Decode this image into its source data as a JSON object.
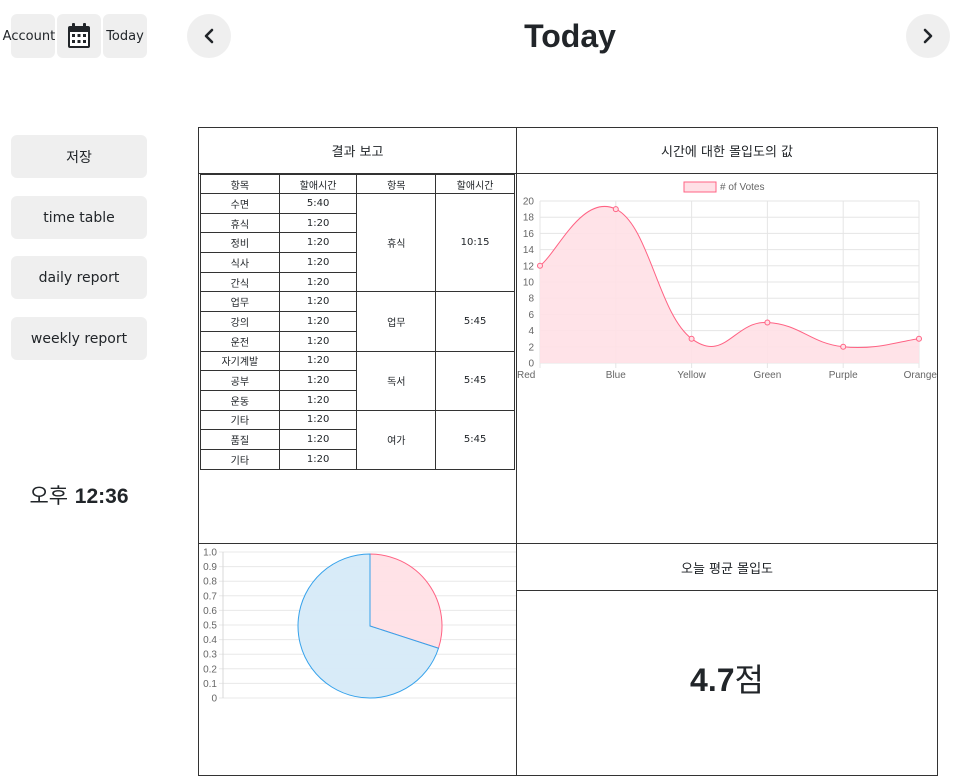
{
  "toolbar": {
    "account_label": "Account",
    "today_label": "Today"
  },
  "header": {
    "title": "Today"
  },
  "sidebar": {
    "items": [
      {
        "label": "저장"
      },
      {
        "label": "time table"
      },
      {
        "label": "daily report"
      },
      {
        "label": "weekly report"
      }
    ]
  },
  "clock": {
    "period": "오후",
    "time": "12:36"
  },
  "report": {
    "title": "결과 보고",
    "columns": [
      "항목",
      "할애시간",
      "항목",
      "할애시간"
    ],
    "rows": [
      {
        "item": "수면",
        "time": "5:40"
      },
      {
        "item": "휴식",
        "time": "1:20"
      },
      {
        "item": "정비",
        "time": "1:20"
      },
      {
        "item": "식사",
        "time": "1:20"
      },
      {
        "item": "간식",
        "time": "1:20"
      },
      {
        "item": "업무",
        "time": "1:20"
      },
      {
        "item": "강의",
        "time": "1:20"
      },
      {
        "item": "운전",
        "time": "1:20"
      },
      {
        "item": "자기계발",
        "time": "1:20"
      },
      {
        "item": "공부",
        "time": "1:20"
      },
      {
        "item": "운동",
        "time": "1:20"
      },
      {
        "item": "기타",
        "time": "1:20"
      },
      {
        "item": "품질",
        "time": "1:20"
      },
      {
        "item": "기타",
        "time": "1:20"
      }
    ],
    "groups": [
      {
        "item": "휴식",
        "time": "10:15"
      },
      {
        "item": "업무",
        "time": "5:45"
      },
      {
        "item": "독서",
        "time": "5:45"
      },
      {
        "item": "여가",
        "time": "5:45"
      }
    ]
  },
  "line_panel": {
    "title": "시간에 대한 몰입도의 값"
  },
  "avg_panel": {
    "title": "오늘 평균 몰입도",
    "value": "4.7",
    "unit": "점"
  },
  "chart_data": [
    {
      "type": "area",
      "title": "",
      "categories": [
        "Red",
        "Blue",
        "Yellow",
        "Green",
        "Purple",
        "Orange"
      ],
      "series": [
        {
          "name": "# of Votes",
          "values": [
            12,
            19,
            3,
            5,
            2,
            3
          ]
        }
      ],
      "ylim": [
        0,
        20
      ],
      "yticks": [
        0,
        2,
        4,
        6,
        8,
        10,
        12,
        14,
        16,
        18,
        20
      ],
      "grid": true,
      "legend": "top-center",
      "colors": {
        "stroke": "#ff6384",
        "fill": "#ffe0e6"
      }
    },
    {
      "type": "pie",
      "title": "",
      "slices": [
        0.3,
        0.7
      ],
      "colors": [
        "#ffe0e6",
        "#d6eaf8"
      ],
      "stroke_colors": [
        "#ff6384",
        "#36a2eb"
      ],
      "axis_ylim": [
        0,
        1.0
      ],
      "axis_yticks": [
        "1.0",
        "0.9",
        "0.8",
        "0.7",
        "0.6",
        "0.5",
        "0.4",
        "0.3",
        "0.2",
        "0.1",
        "0"
      ],
      "grid": true
    }
  ]
}
